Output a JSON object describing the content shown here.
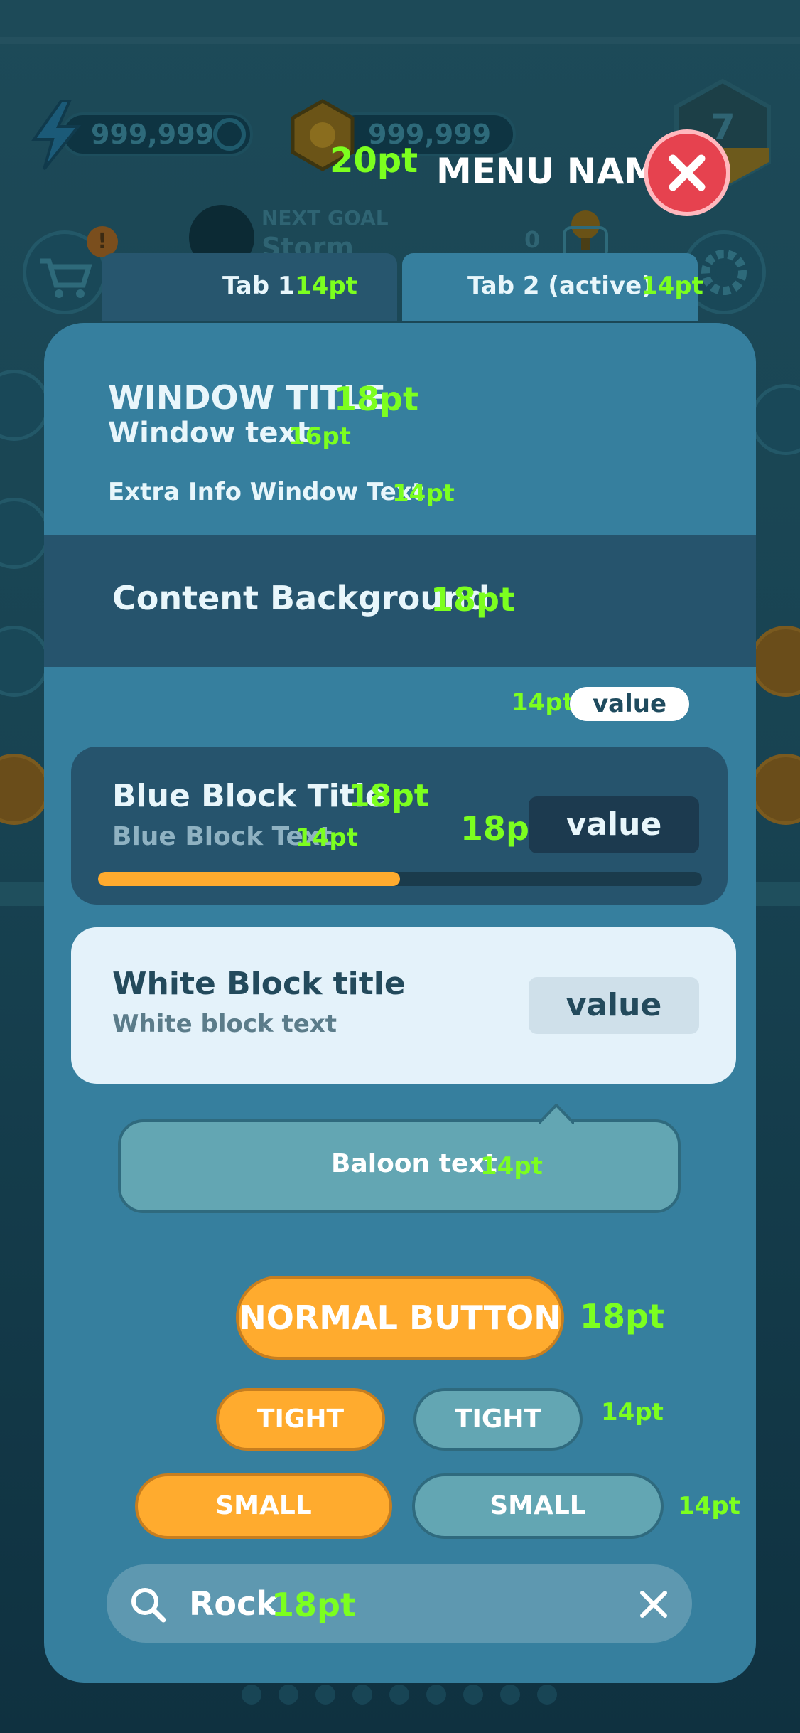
{
  "hud": {
    "energy_value": "999,999",
    "coins_value": "999,999",
    "level_number": "7",
    "goal_label": "NEXT GOAL",
    "goal_name": "Storm",
    "bulb_count": "0",
    "notification_badge": "!"
  },
  "header": {
    "title_size": "20pt",
    "title": "MENU NAME"
  },
  "tabs": [
    {
      "label": "Tab 1",
      "size": "14pt"
    },
    {
      "label": "Tab 2 (active)",
      "size": "14pt"
    }
  ],
  "window": {
    "title": "WINDOW TITLE",
    "title_size": "18pt",
    "text": "Window text",
    "text_size": "16pt",
    "extra": "Extra Info Window Text",
    "extra_size": "14pt"
  },
  "content_bg": {
    "label": "Content Background",
    "size": "18pt"
  },
  "value_tag": {
    "size": "14pt",
    "label": "value"
  },
  "blue_block": {
    "title": "Blue Block Title",
    "title_size": "18pt",
    "text": "Blue Block Text",
    "text_size": "14pt",
    "value_size": "18pt",
    "value": "value",
    "progress": 0.5
  },
  "white_block": {
    "title": "White Block title",
    "text": "White block text",
    "value": "value"
  },
  "balloon": {
    "text": "Baloon text",
    "size": "14pt"
  },
  "buttons": {
    "normal_label": "NORMAL BUTTON",
    "normal_size": "18pt",
    "tight_orange": "TIGHT",
    "tight_teal": "TIGHT",
    "tight_size": "14pt",
    "small_orange": "SMALL",
    "small_teal": "SMALL",
    "small_size": "14pt"
  },
  "search": {
    "value": "Rock",
    "size": "18pt"
  },
  "page_dots": 9,
  "colors": {
    "panel": "#367f9e",
    "content_band": "#26546d",
    "size_annotation": "#7cff1f",
    "orange_button": "#ffab2e",
    "teal_button": "#63a6b3",
    "close_button": "#e6424f"
  }
}
